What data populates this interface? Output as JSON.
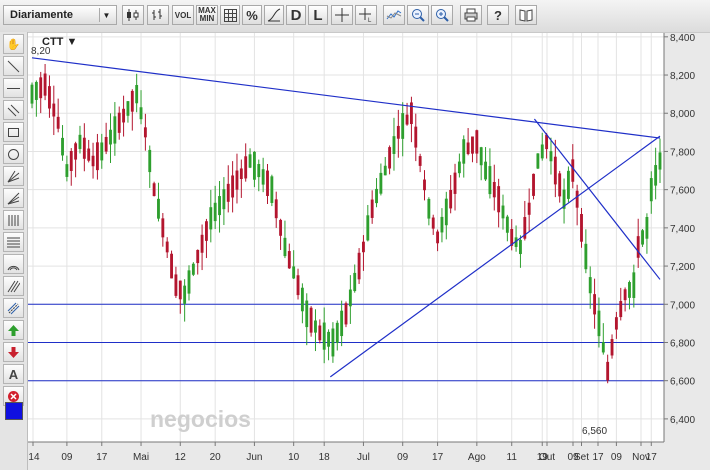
{
  "toolbar": {
    "period_select": "Diariamente",
    "vol_label": "VOL",
    "maxmin_line1": "MAX",
    "maxmin_line2": "MIN",
    "percent_label": "%",
    "d_label": "D",
    "l_label": "L",
    "help_label": "?"
  },
  "left_tools": {
    "text_tool_label": "A"
  },
  "chart_data": {
    "type": "candlestick",
    "symbol": "CTT ▼",
    "start_value_label": "8,20",
    "low_label": "6,560",
    "watermark": "negocios",
    "yaxis": {
      "ylim": [
        6.3,
        8.42
      ],
      "ticks": [
        {
          "value": 8.4,
          "label": "8,400"
        },
        {
          "value": 8.2,
          "label": "8,200"
        },
        {
          "value": 8.0,
          "label": "8,000"
        },
        {
          "value": 7.8,
          "label": "7,800"
        },
        {
          "value": 7.6,
          "label": "7,600"
        },
        {
          "value": 7.4,
          "label": "7,400"
        },
        {
          "value": 7.2,
          "label": "7,200"
        },
        {
          "value": 7.0,
          "label": "7,000"
        },
        {
          "value": 6.8,
          "label": "6,800"
        },
        {
          "value": 6.6,
          "label": "6,600"
        },
        {
          "value": 6.4,
          "label": "6,400"
        }
      ]
    },
    "xaxis": {
      "n": 145,
      "ticks": [
        {
          "i": 0,
          "label": "'14"
        },
        {
          "i": 8,
          "label": "09"
        },
        {
          "i": 16,
          "label": "17"
        },
        {
          "i": 25,
          "label": "Mai"
        },
        {
          "i": 34,
          "label": "12"
        },
        {
          "i": 42,
          "label": "20"
        },
        {
          "i": 51,
          "label": "Jun"
        },
        {
          "i": 60,
          "label": "10"
        },
        {
          "i": 67,
          "label": "18"
        },
        {
          "i": 76,
          "label": "Jul"
        },
        {
          "i": 85,
          "label": "09"
        },
        {
          "i": 93,
          "label": "17"
        },
        {
          "i": 102,
          "label": "Ago"
        },
        {
          "i": 110,
          "label": "11"
        },
        {
          "i": 117,
          "label": "19"
        },
        {
          "i": 126,
          "label": "Set"
        },
        {
          "i": 134,
          "label": "09"
        },
        {
          "i": 142,
          "label": "17"
        }
      ]
    },
    "xaxis_extra_ticks": [
      {
        "x": 547,
        "label": "Out"
      },
      {
        "x": 573,
        "label": "09"
      },
      {
        "x": 598,
        "label": "17"
      },
      {
        "x": 641,
        "label": "Nov"
      }
    ],
    "horizontal_lines": [
      7.0,
      6.8,
      6.6
    ],
    "trendlines": [
      {
        "from": [
          0.0,
          8.29
        ],
        "to": [
          1.0,
          7.87
        ]
      },
      {
        "from": [
          0.475,
          6.62
        ],
        "to": [
          1.0,
          7.88
        ]
      },
      {
        "from": [
          0.8,
          7.97
        ],
        "to": [
          1.0,
          7.13
        ]
      }
    ],
    "up_color": "#2e9f2e",
    "down_color": "#b3152e",
    "line_color": "#1f2fc8"
  }
}
